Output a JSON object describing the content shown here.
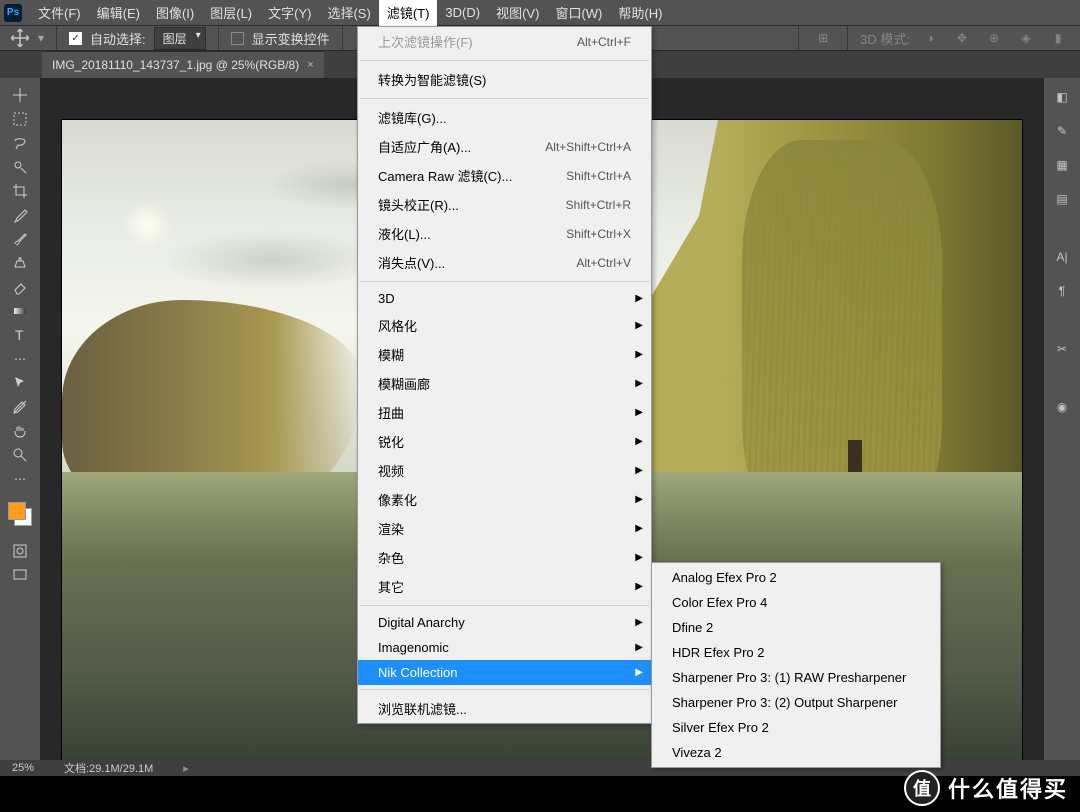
{
  "menubar": {
    "items": [
      "文件(F)",
      "编辑(E)",
      "图像(I)",
      "图层(L)",
      "文字(Y)",
      "选择(S)",
      "滤镜(T)",
      "3D(D)",
      "视图(V)",
      "窗口(W)",
      "帮助(H)"
    ],
    "active_index": 6
  },
  "options": {
    "auto_select": "自动选择:",
    "layer_dd": "图层",
    "show_transform": "显示变换控件",
    "mode_3d": "3D 模式:"
  },
  "tab": {
    "title": "IMG_20181110_143737_1.jpg @ 25%(RGB/8)",
    "close": "×"
  },
  "status": {
    "zoom": "25%",
    "doc": "文档:29.1M/29.1M"
  },
  "filter_menu": {
    "last_op": {
      "label": "上次滤镜操作(F)",
      "shortcut": "Alt+Ctrl+F"
    },
    "smart": {
      "label": "转换为智能滤镜(S)"
    },
    "gallery": {
      "label": "滤镜库(G)..."
    },
    "adaptive": {
      "label": "自适应广角(A)...",
      "shortcut": "Alt+Shift+Ctrl+A"
    },
    "camera_raw": {
      "label": "Camera Raw 滤镜(C)...",
      "shortcut": "Shift+Ctrl+A"
    },
    "lens": {
      "label": "镜头校正(R)...",
      "shortcut": "Shift+Ctrl+R"
    },
    "liquify": {
      "label": "液化(L)...",
      "shortcut": "Shift+Ctrl+X"
    },
    "vanish": {
      "label": "消失点(V)...",
      "shortcut": "Alt+Ctrl+V"
    },
    "sub": [
      "3D",
      "风格化",
      "模糊",
      "模糊画廊",
      "扭曲",
      "锐化",
      "视频",
      "像素化",
      "渲染",
      "杂色",
      "其它"
    ],
    "plugins": [
      "Digital Anarchy",
      "Imagenomic",
      "Nik Collection"
    ],
    "browse": "浏览联机滤镜..."
  },
  "nik_submenu": [
    "Analog Efex Pro 2",
    "Color Efex Pro 4",
    "Dfine 2",
    "HDR Efex Pro 2",
    "Sharpener Pro 3: (1) RAW Presharpener",
    "Sharpener Pro 3: (2) Output Sharpener",
    "Silver Efex Pro 2",
    "Viveza 2"
  ],
  "watermark": {
    "badge": "值",
    "text": "什么值得买"
  }
}
